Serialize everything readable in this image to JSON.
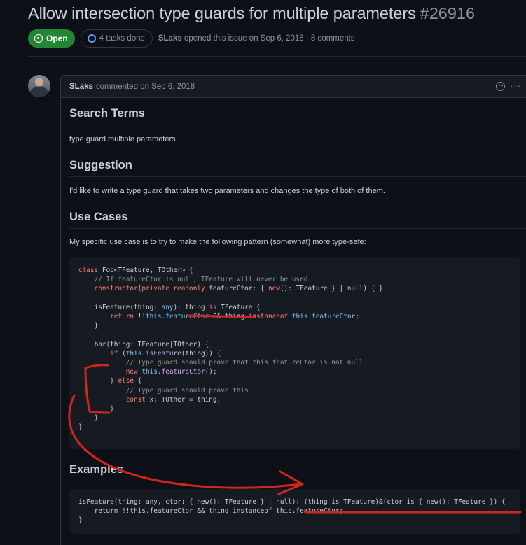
{
  "issue": {
    "title": "Allow intersection type guards for multiple parameters",
    "number": "#26916",
    "state_label": "Open",
    "tasks_label": "4 tasks done",
    "author": "SLaks",
    "opened_text": "opened this issue on Sep 6, 2018 · 8 comments"
  },
  "comment": {
    "author": "SLaks",
    "commented_text": "commented on Sep 6, 2018",
    "search_terms_heading": "Search Terms",
    "search_terms_text": "type guard multiple parameters",
    "suggestion_heading": "Suggestion",
    "suggestion_text": "I'd like to write a type guard that takes two parameters and changes the type of both of them.",
    "use_cases_heading": "Use Cases",
    "use_cases_text": "My specific use case is to try to make the following pattern (somewhat) more type-safe:",
    "examples_heading": "Examples"
  },
  "icons": {
    "open": "issue-open-icon",
    "tasks": "task-progress-icon",
    "emoji": "smiley-icon",
    "menu": "kebab-horizontal-icon"
  },
  "colors": {
    "background": "#0d1117",
    "open_green": "#238636",
    "annotation_red": "#d1261e",
    "keyword": "#ff7b72",
    "comment": "#8b949e",
    "type": "#79c0ff"
  }
}
